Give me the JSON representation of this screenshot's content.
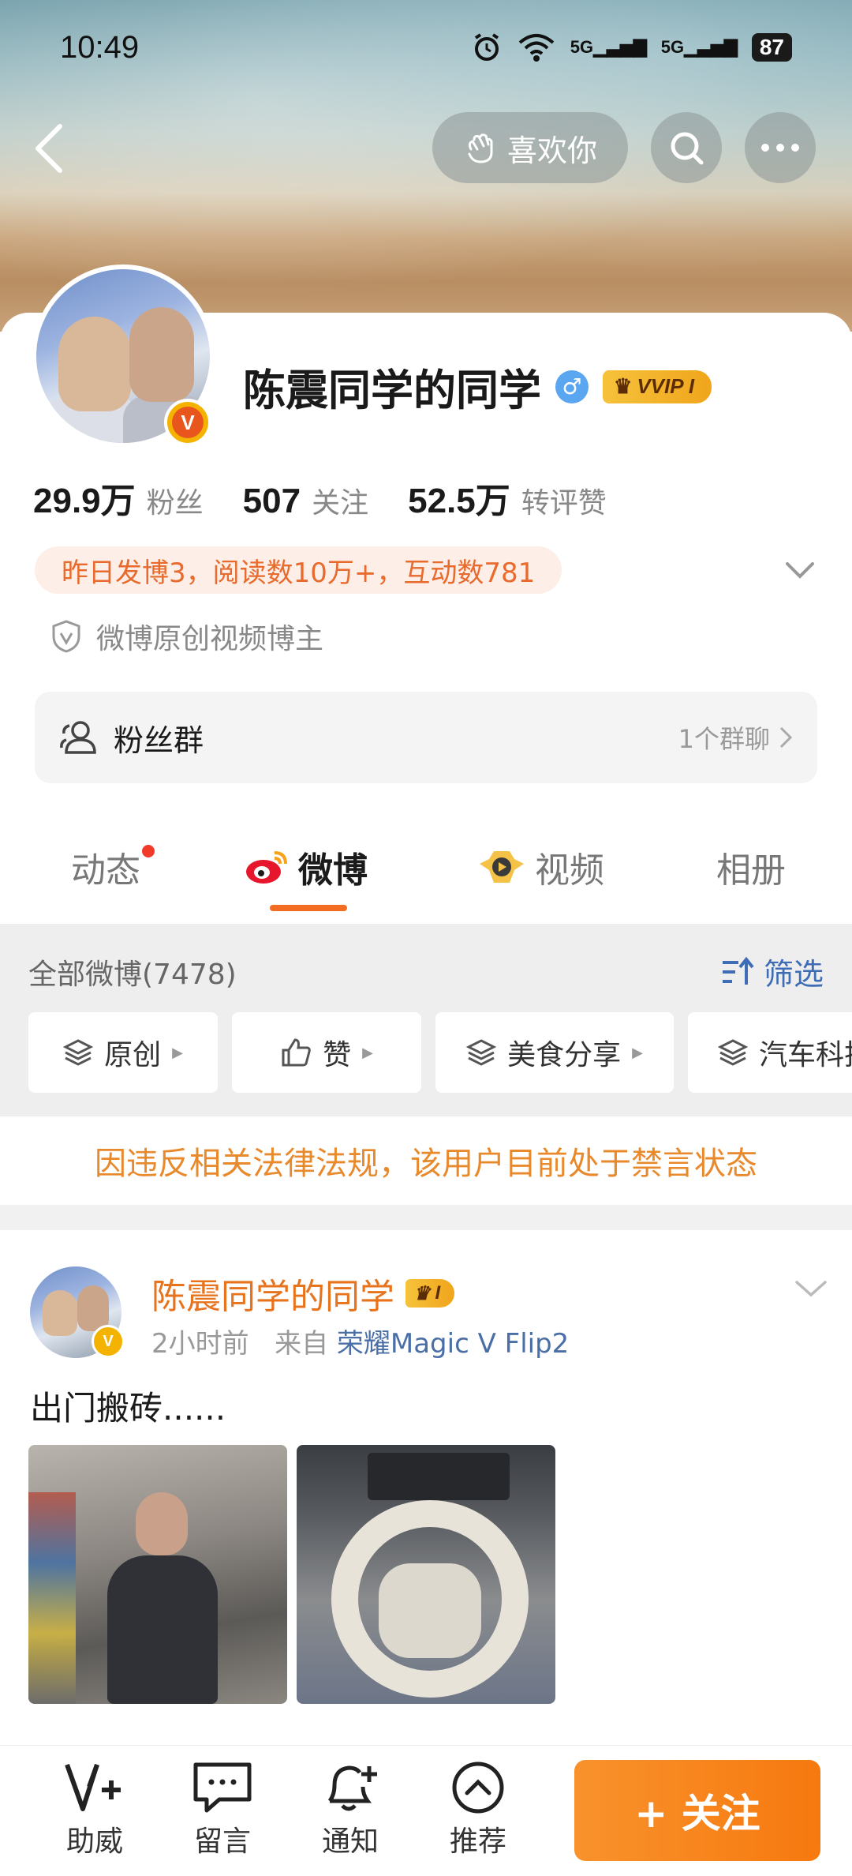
{
  "status_bar": {
    "time": "10:49",
    "signal1": "5G",
    "signal2": "5G",
    "battery": "87"
  },
  "header": {
    "like_label": "喜欢你"
  },
  "profile": {
    "name": "陈震同学的同学",
    "vip_badge": "VVIP I",
    "gender": "♂",
    "v_badge": "V",
    "stats": [
      {
        "value": "29.9万",
        "label": "粉丝"
      },
      {
        "value": "507",
        "label": "关注"
      },
      {
        "value": "52.5万",
        "label": "转评赞"
      }
    ],
    "activity": "昨日发博3，阅读数10万+，互动数781",
    "certification": "微博原创视频博主",
    "fan_group": {
      "label": "粉丝群",
      "count": "1个群聊"
    }
  },
  "tabs": [
    "动态",
    "微博",
    "视频",
    "相册"
  ],
  "filter": {
    "all_posts": "全部微博(7478)",
    "filter_label": "筛选",
    "chips": [
      "原创",
      "赞",
      "美食分享",
      "汽车科技"
    ]
  },
  "ban_notice": "因违反相关法律法规，该用户目前处于禁言状态",
  "post": {
    "author": "陈震同学的同学",
    "vip_badge": "I",
    "time": "2小时前",
    "from_label": "来自",
    "device": "荣耀Magic V Flip2",
    "text": "出门搬砖......"
  },
  "bottom_bar": {
    "items": [
      "助威",
      "留言",
      "通知",
      "推荐"
    ],
    "follow": "+ 关注"
  },
  "colors": {
    "accent": "#f6790f",
    "link": "#4a6fa6",
    "warning": "#e8892c"
  }
}
